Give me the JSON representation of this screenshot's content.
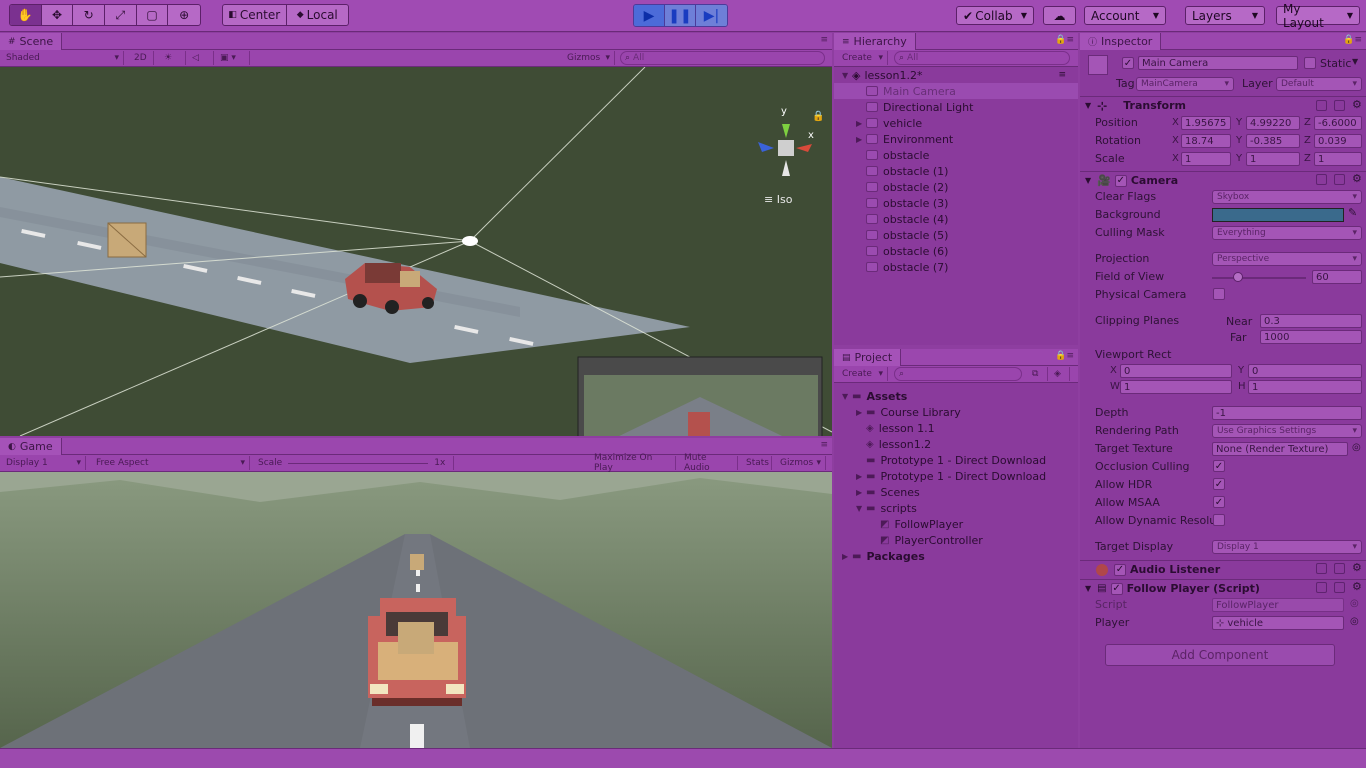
{
  "toolbar": {
    "pivot_center": "Center",
    "pivot_local": "Local",
    "collab": "Collab",
    "account": "Account",
    "layers": "Layers",
    "layout": "My Layout"
  },
  "scene": {
    "tab": "Scene",
    "shading": "Shaded",
    "mode_2d": "2D",
    "gizmos": "Gizmos",
    "search_placeholder": "All",
    "iso_label": "Iso",
    "axis_x": "x",
    "axis_y": "y"
  },
  "game": {
    "tab": "Game",
    "display": "Display 1",
    "aspect": "Free Aspect",
    "scale_label": "Scale",
    "scale_value": "1x",
    "maximize": "Maximize On Play",
    "mute": "Mute Audio",
    "stats": "Stats",
    "gizmos": "Gizmos"
  },
  "hierarchy": {
    "tab": "Hierarchy",
    "create": "Create",
    "search_placeholder": "All",
    "scene_name": "lesson1.2*",
    "items": [
      {
        "label": "Main Camera",
        "arrow": ""
      },
      {
        "label": "Directional Light",
        "arrow": ""
      },
      {
        "label": "vehicle",
        "arrow": "▶"
      },
      {
        "label": "Environment",
        "arrow": "▶"
      },
      {
        "label": "obstacle",
        "arrow": ""
      },
      {
        "label": "obstacle (1)",
        "arrow": ""
      },
      {
        "label": "obstacle (2)",
        "arrow": ""
      },
      {
        "label": "obstacle (3)",
        "arrow": ""
      },
      {
        "label": "obstacle (4)",
        "arrow": ""
      },
      {
        "label": "obstacle (5)",
        "arrow": ""
      },
      {
        "label": "obstacle (6)",
        "arrow": ""
      },
      {
        "label": "obstacle (7)",
        "arrow": ""
      }
    ]
  },
  "project": {
    "tab": "Project",
    "create": "Create",
    "items": [
      {
        "label": "Assets",
        "bold": true
      },
      {
        "label": "Course Library"
      },
      {
        "label": "lesson 1.1"
      },
      {
        "label": "lesson1.2"
      },
      {
        "label": "Prototype 1 - Direct Download"
      },
      {
        "label": "Prototype 1 - Direct Download"
      },
      {
        "label": "Scenes"
      },
      {
        "label": "scripts"
      },
      {
        "label": "FollowPlayer"
      },
      {
        "label": "PlayerController"
      },
      {
        "label": "Packages",
        "bold": true
      }
    ]
  },
  "inspector": {
    "tab": "Inspector",
    "object_name": "Main Camera",
    "static_label": "Static",
    "tag_label": "Tag",
    "tag_value": "MainCamera",
    "layer_label": "Layer",
    "layer_value": "Default",
    "transform": {
      "title": "Transform",
      "position_label": "Position",
      "rotation_label": "Rotation",
      "scale_label": "Scale",
      "position": {
        "x": "1.95675",
        "y": "4.99220",
        "z": "-6.6000"
      },
      "rotation": {
        "x": "18.74",
        "y": "-0.385",
        "z": "0.039"
      },
      "scale": {
        "x": "1",
        "y": "1",
        "z": "1"
      }
    },
    "camera": {
      "title": "Camera",
      "clear_flags_label": "Clear Flags",
      "clear_flags": "Skybox",
      "background_label": "Background",
      "background_color": "#3a6a8c",
      "culling_mask_label": "Culling Mask",
      "culling_mask": "Everything",
      "projection_label": "Projection",
      "projection": "Perspective",
      "fov_label": "Field of View",
      "fov": "60",
      "fov_fraction": 0.28,
      "physical_label": "Physical Camera",
      "clipping_label": "Clipping Planes",
      "near_label": "Near",
      "near": "0.3",
      "far_label": "Far",
      "far": "1000",
      "viewport_label": "Viewport Rect",
      "vx": "0",
      "vy": "0",
      "vw": "1",
      "vh": "1",
      "depth_label": "Depth",
      "depth": "-1",
      "rendering_path_label": "Rendering Path",
      "rendering_path": "Use Graphics Settings",
      "target_texture_label": "Target Texture",
      "target_texture": "None (Render Texture)",
      "occlusion_label": "Occlusion Culling",
      "hdr_label": "Allow HDR",
      "msaa_label": "Allow MSAA",
      "dynres_label": "Allow Dynamic Resolu",
      "target_display_label": "Target Display",
      "target_display": "Display 1"
    },
    "audio_listener": {
      "title": "Audio Listener"
    },
    "follow_player": {
      "title": "Follow Player (Script)",
      "script_label": "Script",
      "script_value": "FollowPlayer",
      "player_label": "Player",
      "player_value": "vehicle"
    },
    "add_component": "Add Component"
  }
}
